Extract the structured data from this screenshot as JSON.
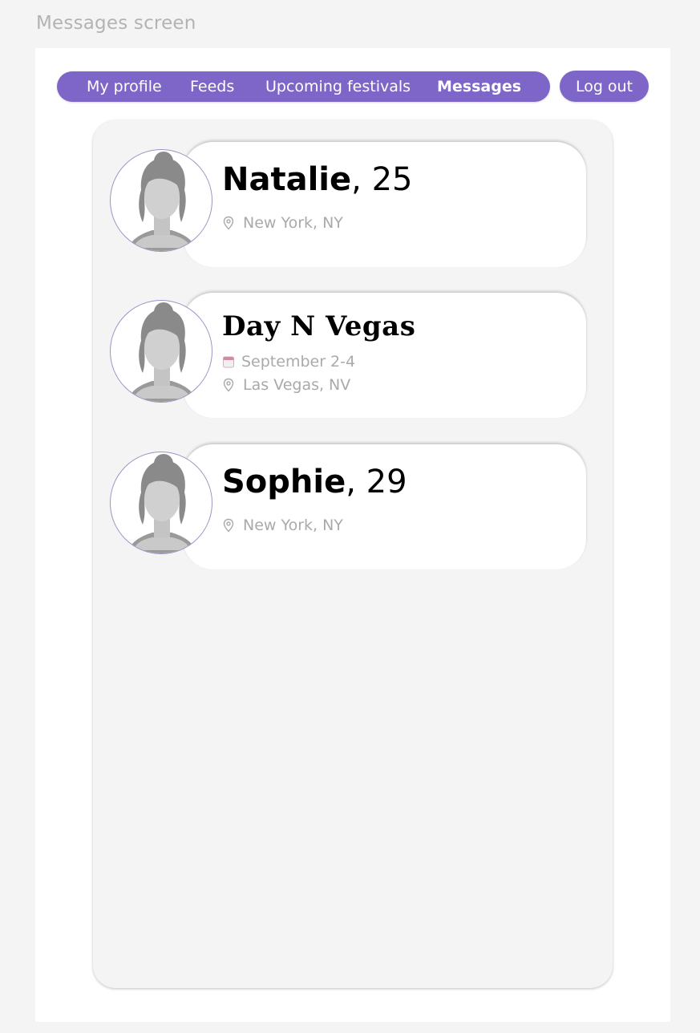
{
  "screen_title": "Messages screen",
  "nav": {
    "items": [
      {
        "label": "My profile"
      },
      {
        "label": "Feeds"
      },
      {
        "label": "Upcoming festivals"
      },
      {
        "label": "Messages"
      }
    ],
    "logout_label": "Log out",
    "accent_color": "#7d66c7"
  },
  "messages": [
    {
      "name": "Natalie",
      "age": ", 25",
      "location": "New York, NY",
      "avatar_icon": "female-avatar-icon"
    },
    {
      "festival": "Day N Vegas",
      "dates": "September 2-4",
      "location": "Las Vegas, NV",
      "avatar_icon": "female-avatar-icon"
    },
    {
      "name": "Sophie",
      "age": ", 29",
      "location": "New York, NY",
      "avatar_icon": "female-avatar-icon"
    }
  ],
  "icons": {
    "location": "location-pin-icon",
    "date": "calendar-icon"
  }
}
